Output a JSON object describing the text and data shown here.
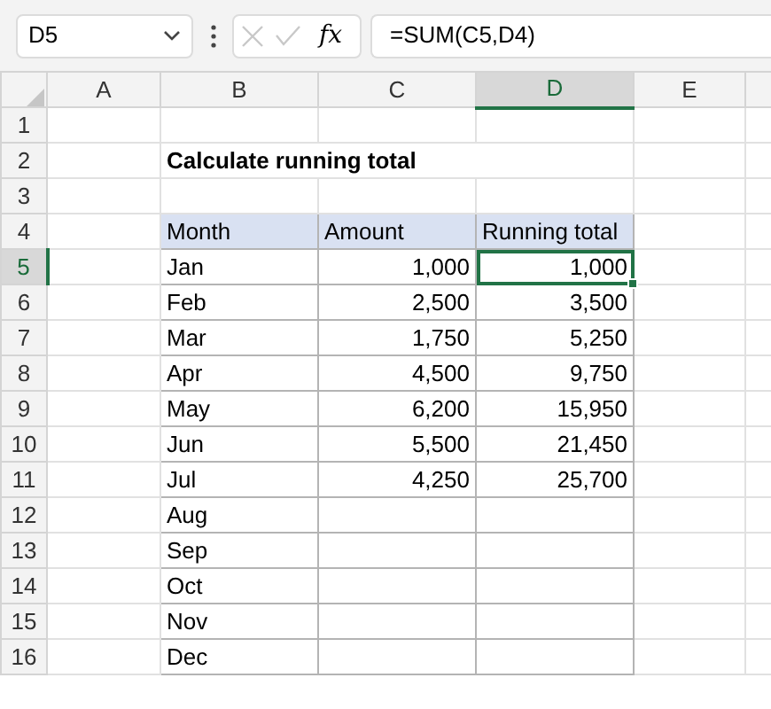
{
  "formula_bar": {
    "name_box": "D5",
    "function_label": "fx",
    "formula": "=SUM(C5,D4)"
  },
  "columns": [
    {
      "label": "A",
      "selected": false
    },
    {
      "label": "B",
      "selected": false
    },
    {
      "label": "C",
      "selected": false
    },
    {
      "label": "D",
      "selected": true
    },
    {
      "label": "E",
      "selected": false
    }
  ],
  "rows": [
    {
      "number": "1",
      "selected": false
    },
    {
      "number": "2",
      "selected": false,
      "title": "Calculate running total"
    },
    {
      "number": "3",
      "selected": false
    },
    {
      "number": "4",
      "selected": false,
      "table": [
        {
          "kind": "header",
          "text": "Month"
        },
        {
          "kind": "header",
          "text": "Amount"
        },
        {
          "kind": "header",
          "text": "Running total"
        }
      ]
    },
    {
      "number": "5",
      "selected": true,
      "table": [
        {
          "kind": "text",
          "text": "Jan"
        },
        {
          "kind": "number",
          "text": "1,000"
        },
        {
          "kind": "number",
          "text": "1,000",
          "selected": true
        }
      ]
    },
    {
      "number": "6",
      "selected": false,
      "table": [
        {
          "kind": "text",
          "text": "Feb"
        },
        {
          "kind": "number",
          "text": "2,500"
        },
        {
          "kind": "number",
          "text": "3,500",
          "selected": false
        }
      ]
    },
    {
      "number": "7",
      "selected": false,
      "table": [
        {
          "kind": "text",
          "text": "Mar"
        },
        {
          "kind": "number",
          "text": "1,750"
        },
        {
          "kind": "number",
          "text": "5,250",
          "selected": false
        }
      ]
    },
    {
      "number": "8",
      "selected": false,
      "table": [
        {
          "kind": "text",
          "text": "Apr"
        },
        {
          "kind": "number",
          "text": "4,500"
        },
        {
          "kind": "number",
          "text": "9,750",
          "selected": false
        }
      ]
    },
    {
      "number": "9",
      "selected": false,
      "table": [
        {
          "kind": "text",
          "text": "May"
        },
        {
          "kind": "number",
          "text": "6,200"
        },
        {
          "kind": "number",
          "text": "15,950",
          "selected": false
        }
      ]
    },
    {
      "number": "10",
      "selected": false,
      "table": [
        {
          "kind": "text",
          "text": "Jun"
        },
        {
          "kind": "number",
          "text": "5,500"
        },
        {
          "kind": "number",
          "text": "21,450",
          "selected": false
        }
      ]
    },
    {
      "number": "11",
      "selected": false,
      "table": [
        {
          "kind": "text",
          "text": "Jul"
        },
        {
          "kind": "number",
          "text": "4,250"
        },
        {
          "kind": "number",
          "text": "25,700",
          "selected": false
        }
      ]
    },
    {
      "number": "12",
      "selected": false,
      "table": [
        {
          "kind": "text",
          "text": "Aug"
        },
        {
          "kind": "empty"
        },
        {
          "kind": "empty"
        }
      ]
    },
    {
      "number": "13",
      "selected": false,
      "table": [
        {
          "kind": "text",
          "text": "Sep"
        },
        {
          "kind": "empty"
        },
        {
          "kind": "empty"
        }
      ]
    },
    {
      "number": "14",
      "selected": false,
      "table": [
        {
          "kind": "text",
          "text": "Oct"
        },
        {
          "kind": "empty"
        },
        {
          "kind": "empty"
        }
      ]
    },
    {
      "number": "15",
      "selected": false,
      "table": [
        {
          "kind": "text",
          "text": "Nov"
        },
        {
          "kind": "empty"
        },
        {
          "kind": "empty"
        }
      ]
    },
    {
      "number": "16",
      "selected": false,
      "table": [
        {
          "kind": "text",
          "text": "Dec"
        },
        {
          "kind": "empty"
        },
        {
          "kind": "empty"
        }
      ]
    }
  ]
}
